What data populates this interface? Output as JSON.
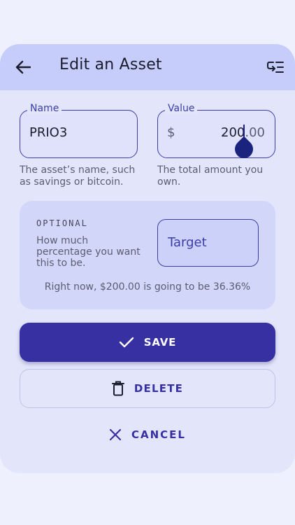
{
  "header": {
    "title": "Edit an Asset"
  },
  "name_field": {
    "label": "Name",
    "value": "PRIO3",
    "helper": "The asset’s name, such as savings or bitcoin."
  },
  "value_field": {
    "label": "Value",
    "prefix": "$",
    "value": "200",
    "decimals": ".00",
    "helper": "The total amount you own."
  },
  "optional": {
    "label": "OPTIONAL",
    "description": "How much percentage you want this to be.",
    "target_placeholder": "Target",
    "summary": "Right now, $200.00 is going to be 36.36%"
  },
  "actions": {
    "save": "SAVE",
    "delete": "DELETE",
    "cancel": "CANCEL"
  },
  "colors": {
    "primary": "#3730a3",
    "header": "#c6cdfa",
    "card": "#e3e6fb"
  },
  "icons": {
    "back": "arrow-left-icon",
    "reorder": "reorder-icon",
    "save": "check-icon",
    "delete": "trash-icon",
    "cancel": "close-icon"
  }
}
